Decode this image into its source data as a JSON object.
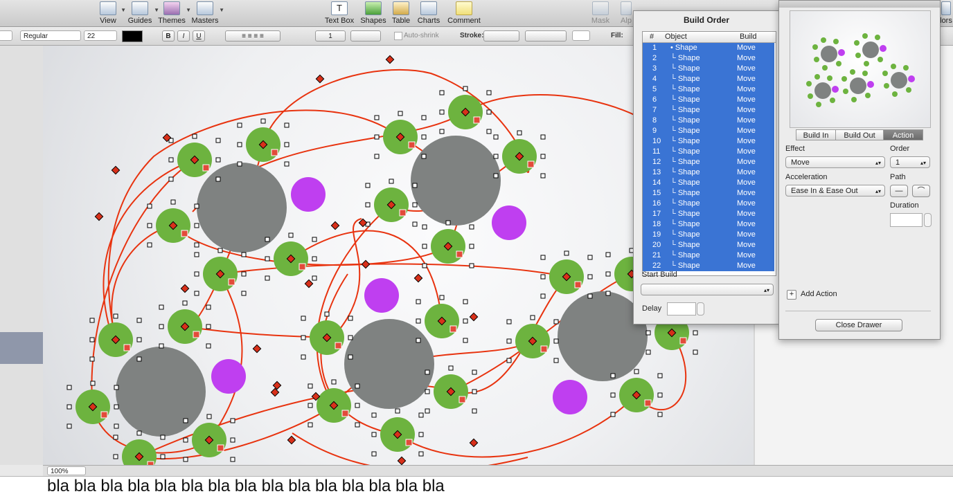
{
  "toolbar": {
    "view": "View",
    "guides": "Guides",
    "themes": "Themes",
    "masters": "Masters",
    "text_box": "Text Box",
    "shapes": "Shapes",
    "table": "Table",
    "charts": "Charts",
    "comment": "Comment",
    "mask": "Mask",
    "alpha": "Alp",
    "colors": "lors"
  },
  "formatbar": {
    "font_style": "Regular",
    "font_size": "22",
    "bold": "B",
    "italic": "I",
    "underline": "U",
    "line_spacing": "1",
    "auto_shrink": "Auto-shrink",
    "stroke_label": "Stroke:",
    "fill_label": "Fill:"
  },
  "zoom": "100%",
  "notes_text": "bla bla bla bla bla bla bla bla bla bla bla bla bla bla bla",
  "build_order": {
    "title": "Build Order",
    "col_num": "#",
    "col_object": "Object",
    "col_build": "Build",
    "rows": [
      {
        "n": "1",
        "object": "• Shape",
        "build": "Move"
      },
      {
        "n": "2",
        "object": "└ Shape",
        "build": "Move"
      },
      {
        "n": "3",
        "object": "└ Shape",
        "build": "Move"
      },
      {
        "n": "4",
        "object": "└ Shape",
        "build": "Move"
      },
      {
        "n": "5",
        "object": "└ Shape",
        "build": "Move"
      },
      {
        "n": "6",
        "object": "└ Shape",
        "build": "Move"
      },
      {
        "n": "7",
        "object": "└ Shape",
        "build": "Move"
      },
      {
        "n": "8",
        "object": "└ Shape",
        "build": "Move"
      },
      {
        "n": "9",
        "object": "└ Shape",
        "build": "Move"
      },
      {
        "n": "10",
        "object": "└ Shape",
        "build": "Move"
      },
      {
        "n": "11",
        "object": "└ Shape",
        "build": "Move"
      },
      {
        "n": "12",
        "object": "└ Shape",
        "build": "Move"
      },
      {
        "n": "13",
        "object": "└ Shape",
        "build": "Move"
      },
      {
        "n": "14",
        "object": "└ Shape",
        "build": "Move"
      },
      {
        "n": "15",
        "object": "└ Shape",
        "build": "Move"
      },
      {
        "n": "16",
        "object": "└ Shape",
        "build": "Move"
      },
      {
        "n": "17",
        "object": "└ Shape",
        "build": "Move"
      },
      {
        "n": "18",
        "object": "└ Shape",
        "build": "Move"
      },
      {
        "n": "19",
        "object": "└ Shape",
        "build": "Move"
      },
      {
        "n": "20",
        "object": "└ Shape",
        "build": "Move"
      },
      {
        "n": "21",
        "object": "└ Shape",
        "build": "Move"
      },
      {
        "n": "22",
        "object": "└ Shape",
        "build": "Move"
      }
    ],
    "start_build_label": "Start Build",
    "delay_label": "Delay"
  },
  "drawer": {
    "tab_build_in": "Build In",
    "tab_build_out": "Build Out",
    "tab_action": "Action",
    "effect_label": "Effect",
    "effect_value": "Move",
    "order_label": "Order",
    "order_value": "1",
    "acceleration_label": "Acceleration",
    "acceleration_value": "Ease In & Ease Out",
    "path_label": "Path",
    "duration_label": "Duration",
    "add_action": "Add Action",
    "close_drawer": "Close Drawer"
  },
  "colors": {
    "green": "#6db33f",
    "gray": "#7f8281",
    "purple": "#bf3ff0",
    "path": "#e8330f",
    "selection": "#3a74d4"
  }
}
